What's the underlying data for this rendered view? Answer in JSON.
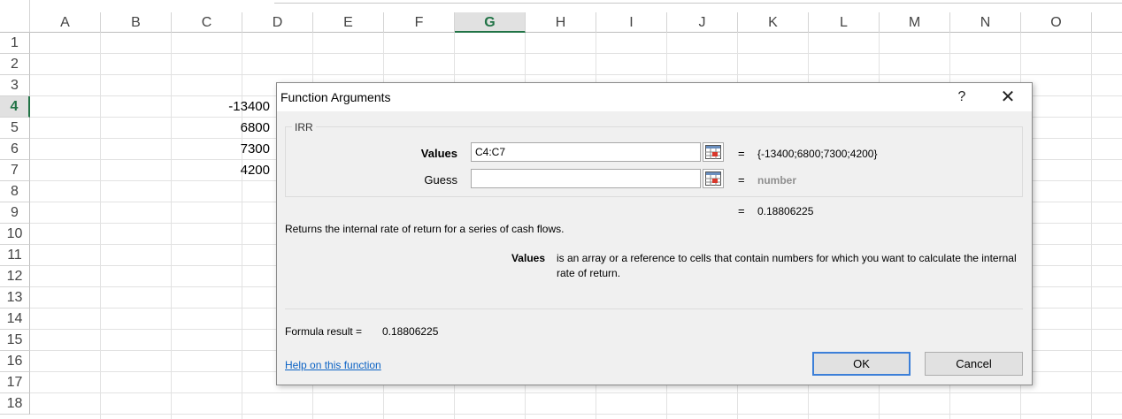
{
  "sheet": {
    "columns": [
      "A",
      "B",
      "C",
      "D",
      "E",
      "F",
      "G",
      "H",
      "I",
      "J",
      "K",
      "L",
      "M",
      "N",
      "O"
    ],
    "selected_column": "G",
    "rows": [
      "1",
      "2",
      "3",
      "4",
      "5",
      "6",
      "7",
      "8",
      "9",
      "10",
      "11",
      "12",
      "13",
      "14",
      "15",
      "16",
      "17",
      "18"
    ],
    "selected_row": "4",
    "cells": [
      {
        "ref": "C4",
        "value": "-13400"
      },
      {
        "ref": "C5",
        "value": "6800"
      },
      {
        "ref": "C6",
        "value": "7300"
      },
      {
        "ref": "C7",
        "value": "4200"
      }
    ]
  },
  "dialog": {
    "title": "Function Arguments",
    "help_glyph": "?",
    "close_glyph": "✕",
    "function_name": "IRR",
    "args": [
      {
        "label": "Values",
        "value": "C4:C7",
        "result": "{-13400;6800;7300;4200}"
      },
      {
        "label": "Guess",
        "value": "",
        "result": "number"
      }
    ],
    "equals_sign": "=",
    "overall_result": "0.18806225",
    "description": "Returns the internal rate of return for a series of cash flows.",
    "param_name": "Values",
    "param_description": "is an array or a reference to cells that contain numbers for which you want to calculate the internal rate of return.",
    "formula_result_label": "Formula result =",
    "formula_result_value": "0.18806225",
    "help_link": "Help on this function",
    "ok_label": "OK",
    "cancel_label": "Cancel"
  }
}
